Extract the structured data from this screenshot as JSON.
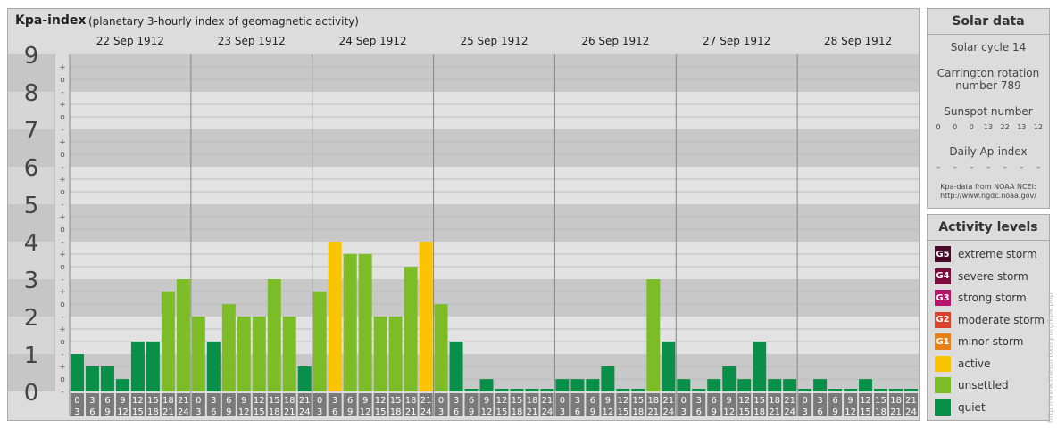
{
  "header": {
    "title": "Kpa-index",
    "subtitle": "(planetary 3-hourly index of geomagnetic activity)"
  },
  "chart_data": {
    "type": "bar",
    "title": "Kpa-index",
    "subtitle": "(planetary 3-hourly index of geomagnetic activity)",
    "ylim": [
      0,
      9
    ],
    "y_major_ticks": [
      "0",
      "1",
      "2",
      "3",
      "4",
      "5",
      "6",
      "7",
      "8",
      "9"
    ],
    "y_minor_ticks": [
      "-",
      "o",
      "+"
    ],
    "days": [
      "22 Sep 1912",
      "23 Sep 1912",
      "24 Sep 1912",
      "25 Sep 1912",
      "26 Sep 1912",
      "27 Sep 1912",
      "28 Sep 1912"
    ],
    "interval_starts": [
      "0",
      "3",
      "6",
      "9",
      "12",
      "15",
      "18",
      "21"
    ],
    "interval_ends": [
      "3",
      "6",
      "9",
      "12",
      "15",
      "18",
      "21",
      "24"
    ],
    "values": [
      [
        1.0,
        0.67,
        0.67,
        0.33,
        1.33,
        1.33,
        2.67,
        3.0
      ],
      [
        2.0,
        1.33,
        2.33,
        2.0,
        2.0,
        3.0,
        2.0,
        0.67
      ],
      [
        2.67,
        4.0,
        3.67,
        3.67,
        2.0,
        2.0,
        3.33,
        4.0
      ],
      [
        2.33,
        1.33,
        0.0,
        0.33,
        0.0,
        0.0,
        0.0,
        0.0
      ],
      [
        0.33,
        0.33,
        0.33,
        0.67,
        0.0,
        0.0,
        3.0,
        1.33
      ],
      [
        0.33,
        0.0,
        0.33,
        0.67,
        0.33,
        1.33,
        0.33,
        0.33
      ],
      [
        0.0,
        0.33,
        0.0,
        0.0,
        0.33,
        0.0,
        0.0,
        0.0
      ]
    ],
    "colors": {
      "quiet": "#0a8f48",
      "unsettled": "#7cbc27",
      "active": "#fbc400"
    }
  },
  "solar": {
    "title": "Solar data",
    "cycle": "Solar cycle 14",
    "carrington_line1": "Carrington rotation",
    "carrington_line2": "number 789",
    "sunspot_label": "Sunspot number",
    "sunspot_values": [
      "0",
      "0",
      "0",
      "13",
      "22",
      "13",
      "12"
    ],
    "ap_label": "Daily Ap-index",
    "ap_values": [
      "–",
      "–",
      "–",
      "–",
      "–",
      "–",
      "–"
    ],
    "source_line1": "Kpa-data from NOAA NCEI:",
    "source_line2": "http://www.ngdc.noaa.gov/"
  },
  "activity": {
    "title": "Activity levels",
    "levels": [
      {
        "badge": "G5",
        "label": "extreme storm",
        "color": "#4a0a2a"
      },
      {
        "badge": "G4",
        "label": "severe storm",
        "color": "#7a0d3e"
      },
      {
        "badge": "G3",
        "label": "strong storm",
        "color": "#b5146a"
      },
      {
        "badge": "G2",
        "label": "moderate storm",
        "color": "#d9412b"
      },
      {
        "badge": "G1",
        "label": "minor storm",
        "color": "#e8801a"
      },
      {
        "badge": "",
        "label": "active",
        "color": "#fbc400"
      },
      {
        "badge": "",
        "label": "unsettled",
        "color": "#7cbc27"
      },
      {
        "badge": "",
        "label": "quiet",
        "color": "#0a8f48"
      }
    ]
  },
  "watermark": "http://www.thesuntoday.org/kpa.php"
}
